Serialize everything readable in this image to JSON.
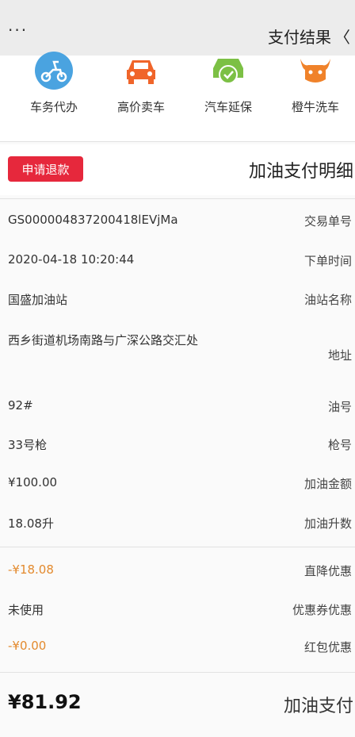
{
  "header": {
    "title": "支付结果",
    "more_icon": "ellipsis",
    "back_icon": "chevron-left"
  },
  "services": [
    {
      "label": "车务代办",
      "icon": "scooter-icon",
      "color": "#4aa3e0"
    },
    {
      "label": "高价卖车",
      "icon": "car-icon",
      "color": "#f0652a"
    },
    {
      "label": "汽车延保",
      "icon": "car-shield-icon",
      "color": "#7cc045"
    },
    {
      "label": "橙牛洗车",
      "icon": "bull-icon",
      "color": "#f0822a"
    }
  ],
  "detail": {
    "title": "加油支付明细",
    "refund_label": "申请退款",
    "refund_color": "#e6283c"
  },
  "rows": {
    "trade_no": {
      "label": "交易单号",
      "value": "GS000004837200418lEVjMa"
    },
    "order_time": {
      "label": "下单时间",
      "value": "2020-04-18 10:20:44"
    },
    "station": {
      "label": "油站名称",
      "value": "国盛加油站"
    },
    "address": {
      "label": "地址",
      "value": "西乡街道机场南路与广深公路交汇处"
    },
    "oil_no": {
      "label": "油号",
      "value": "92#"
    },
    "gun_no": {
      "label": "枪号",
      "value": "33号枪"
    },
    "amount": {
      "label": "加油金额",
      "value": "¥100.00"
    },
    "liters": {
      "label": "加油升数",
      "value": "18.08升"
    },
    "direct_discount": {
      "label": "直降优惠",
      "value": "-¥18.08"
    },
    "coupon_discount": {
      "label": "优惠券优惠",
      "value": "未使用"
    },
    "redpacket_discount": {
      "label": "红包优惠",
      "value": "-¥0.00"
    }
  },
  "total": {
    "label": "加油支付",
    "value": "¥81.92"
  }
}
